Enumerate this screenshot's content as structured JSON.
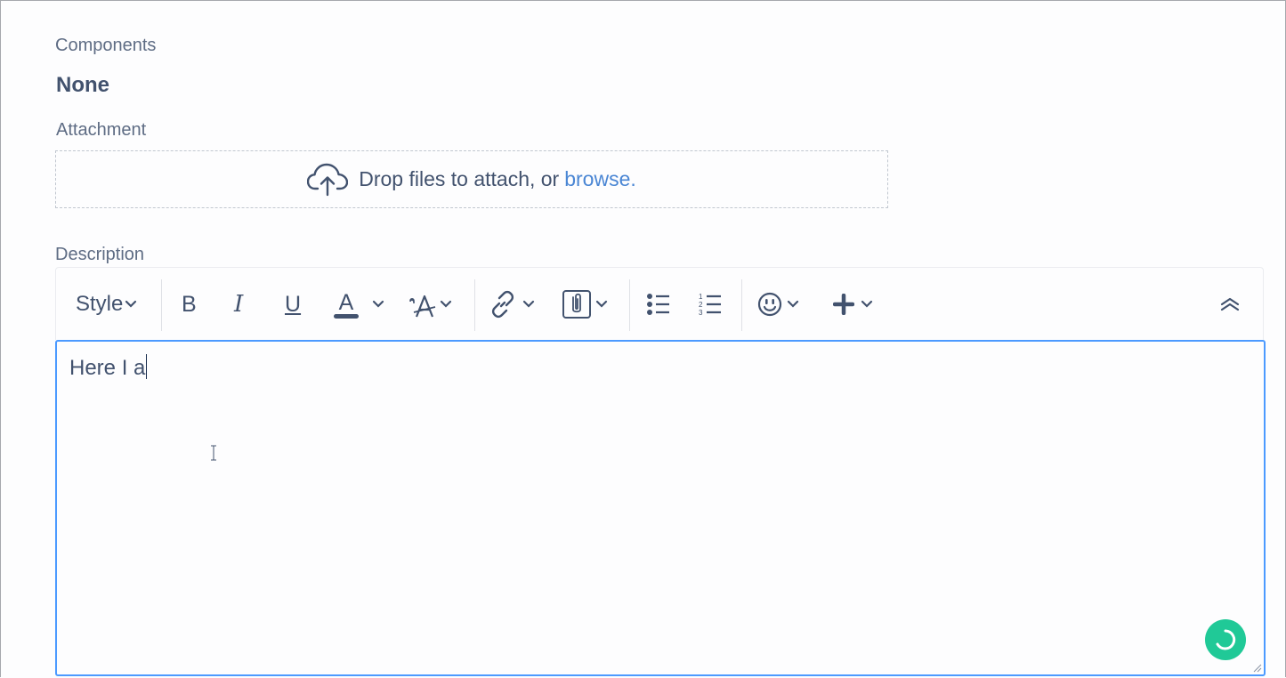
{
  "fields": {
    "components_label": "Components",
    "components_value": "None",
    "attachment_label": "Attachment",
    "description_label": "Description"
  },
  "dropzone": {
    "text": "Drop files to attach, or",
    "browse_link": "browse."
  },
  "toolbar": {
    "style_label": "Style",
    "bold": "B",
    "italic": "I",
    "underline": "U",
    "text_color": "A",
    "text_color_swatch": "#42526e",
    "icons": [
      "cloud-upload-icon",
      "chevron-down-icon",
      "text-color-icon",
      "clear-formatting-icon",
      "link-icon",
      "attachment-icon",
      "bullet-list-icon",
      "numbered-list-icon",
      "emoji-icon",
      "plus-icon",
      "collapse-icon"
    ]
  },
  "editor": {
    "content": "Here I a"
  },
  "colors": {
    "accent": "#4c9aff",
    "link": "#4a86d4",
    "spinner": "#20c997"
  }
}
